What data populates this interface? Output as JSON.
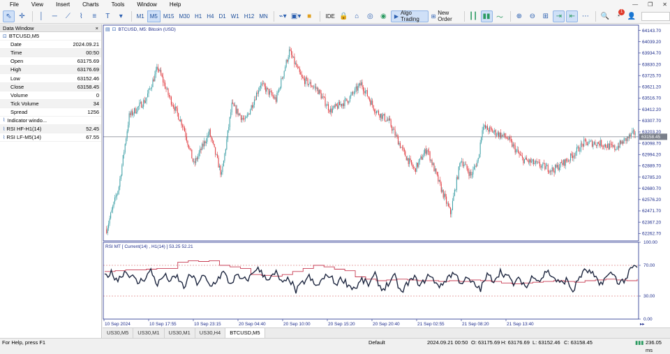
{
  "menu": [
    "File",
    "View",
    "Insert",
    "Charts",
    "Tools",
    "Window",
    "Help"
  ],
  "window_controls": {
    "minimize": "—",
    "restore": "❐",
    "close": "✕"
  },
  "toolbar": {
    "timeframes": [
      "M1",
      "M5",
      "M15",
      "M30",
      "H1",
      "H4",
      "D1",
      "W1",
      "H12",
      "MN"
    ],
    "active_timeframe": "M5",
    "ide_label": "IDE",
    "algo_label": "Algo Trading",
    "new_order_label": "New Order",
    "notify_count": "1"
  },
  "data_window": {
    "title": "Data Window",
    "close": "×",
    "symbol": "BTCUSD,M5",
    "rows": [
      {
        "k": "Date",
        "v": "2024.09.21"
      },
      {
        "k": "Time",
        "v": "00:50"
      },
      {
        "k": "Open",
        "v": "63175.69"
      },
      {
        "k": "High",
        "v": "63176.69"
      },
      {
        "k": "Low",
        "v": "63152.46"
      },
      {
        "k": "Close",
        "v": "63158.45"
      },
      {
        "k": "Volume",
        "v": "0"
      },
      {
        "k": "Tick Volume",
        "v": "34"
      },
      {
        "k": "Spread",
        "v": "1256"
      }
    ],
    "indicator_header": "Indicator windo...",
    "indicators": [
      {
        "k": "RSI HF-H1(14)",
        "v": "52.45"
      },
      {
        "k": "RSI LF-M5(14)",
        "v": "67.55"
      }
    ]
  },
  "chart": {
    "title": "BTCUSD, M5:  Bitcoin (USD)",
    "current_price": "63158.45",
    "price_ticks": [
      "64143.70",
      "64039.20",
      "63934.70",
      "63830.20",
      "63725.70",
      "63621.20",
      "63516.70",
      "63412.20",
      "63307.70",
      "63203.20",
      "63098.70",
      "62994.20",
      "62889.70",
      "62785.20",
      "62680.70",
      "62576.20",
      "62471.70",
      "62367.20",
      "62262.70"
    ],
    "rsi_title": "RSI MT [ Current(14) , H1(14) ]  53.25 52.21",
    "rsi_ticks": [
      "100.00",
      "70.00",
      "30.00",
      "0.00"
    ],
    "time_labels": [
      "10 Sep 2024",
      "10 Sep 17:55",
      "10 Sep 23:15",
      "20 Sep 04:40",
      "20 Sep 10:00",
      "20 Sep 15:20",
      "20 Sep 20:40",
      "21 Sep 02:55",
      "21 Sep 08:20",
      "21 Sep 13:40"
    ]
  },
  "chart_data": [
    {
      "type": "candlestick",
      "title": "BTCUSD, M5:  Bitcoin (USD)",
      "ylim": [
        62200,
        64180
      ],
      "current_price": 63158.45,
      "waypoints": [
        {
          "bar": 0,
          "price": 62300
        },
        {
          "bar": 12,
          "price": 62700
        },
        {
          "bar": 22,
          "price": 63350
        },
        {
          "bar": 38,
          "price": 63500
        },
        {
          "bar": 50,
          "price": 63800
        },
        {
          "bar": 60,
          "price": 63550
        },
        {
          "bar": 75,
          "price": 63250
        },
        {
          "bar": 85,
          "price": 62900
        },
        {
          "bar": 100,
          "price": 63200
        },
        {
          "bar": 112,
          "price": 62800
        },
        {
          "bar": 122,
          "price": 63450
        },
        {
          "bar": 135,
          "price": 63300
        },
        {
          "bar": 150,
          "price": 63650
        },
        {
          "bar": 165,
          "price": 63500
        },
        {
          "bar": 178,
          "price": 63950
        },
        {
          "bar": 190,
          "price": 63700
        },
        {
          "bar": 205,
          "price": 63600
        },
        {
          "bar": 218,
          "price": 63400
        },
        {
          "bar": 235,
          "price": 63500
        },
        {
          "bar": 248,
          "price": 63650
        },
        {
          "bar": 262,
          "price": 63400
        },
        {
          "bar": 275,
          "price": 63300
        },
        {
          "bar": 290,
          "price": 63000
        },
        {
          "bar": 300,
          "price": 62850
        },
        {
          "bar": 312,
          "price": 63050
        },
        {
          "bar": 325,
          "price": 62700
        },
        {
          "bar": 335,
          "price": 62450
        },
        {
          "bar": 345,
          "price": 62950
        },
        {
          "bar": 355,
          "price": 62800
        },
        {
          "bar": 362,
          "price": 62950
        },
        {
          "bar": 366,
          "price": 63250
        },
        {
          "bar": 378,
          "price": 63200
        },
        {
          "bar": 390,
          "price": 63150
        },
        {
          "bar": 405,
          "price": 62950
        },
        {
          "bar": 420,
          "price": 62900
        },
        {
          "bar": 435,
          "price": 62850
        },
        {
          "bar": 450,
          "price": 62950
        },
        {
          "bar": 465,
          "price": 63100
        },
        {
          "bar": 480,
          "price": 63100
        },
        {
          "bar": 495,
          "price": 63050
        },
        {
          "bar": 508,
          "price": 63150
        },
        {
          "bar": 515,
          "price": 63200
        }
      ]
    },
    {
      "type": "line",
      "title": "RSI MT [ Current(14) , H1(14) ]  53.25 52.21",
      "ylim": [
        0,
        100
      ],
      "levels": [
        70,
        30
      ],
      "series": [
        {
          "name": "Current(14)",
          "values": [
            56,
            60,
            51,
            62,
            57,
            47,
            53,
            63,
            45,
            57,
            50,
            55,
            41,
            58,
            47,
            56,
            42,
            51,
            61,
            46,
            56,
            50,
            54,
            67,
            58,
            52,
            60,
            45,
            53,
            36,
            47,
            55,
            42,
            51,
            58,
            46,
            53,
            44,
            40,
            51,
            45,
            57,
            38,
            46,
            55,
            33,
            48,
            53,
            44,
            57,
            50,
            42,
            55,
            60,
            48,
            52,
            45,
            39,
            57,
            51,
            62,
            56,
            46,
            52,
            41,
            58,
            50,
            63,
            55,
            46,
            51,
            36,
            55,
            64,
            58,
            45,
            54,
            60,
            47,
            52,
            67
          ]
        },
        {
          "name": "H1(14)",
          "values": [
            62,
            63,
            64,
            64,
            65,
            66,
            66,
            74,
            76,
            75,
            76,
            70,
            68,
            66,
            58,
            57,
            56,
            58,
            62,
            66,
            70,
            68,
            65,
            63,
            55,
            52,
            50,
            51,
            52,
            51,
            50,
            50,
            49,
            50,
            49,
            51,
            50,
            49,
            47,
            46,
            47,
            48,
            49,
            50,
            49,
            48,
            50,
            51,
            52,
            51,
            50,
            52
          ]
        }
      ]
    }
  ],
  "bottom_tabs": [
    {
      "label": "US30,M5",
      "active": false
    },
    {
      "label": "US30,M1",
      "active": false
    },
    {
      "label": "US30,M1",
      "active": false
    },
    {
      "label": "US30,H4",
      "active": false
    },
    {
      "label": "BTCUSD,M5",
      "active": true
    }
  ],
  "status": {
    "help": "For Help, press F1",
    "profile": "Default",
    "datetime": "2024.09.21 00:50",
    "open": "O: 63175.69",
    "high": "H: 63176.69",
    "low": "L: 63152.46",
    "close": "C: 63158.45",
    "ping": "236.05 ms"
  },
  "colors": {
    "bull": "#3a9ea5",
    "bear": "#e0393e",
    "axis": "#1b2a8a",
    "rsi_fast": "#1e2740",
    "rsi_slow": "#c73a50",
    "level": "#d04a4a"
  }
}
